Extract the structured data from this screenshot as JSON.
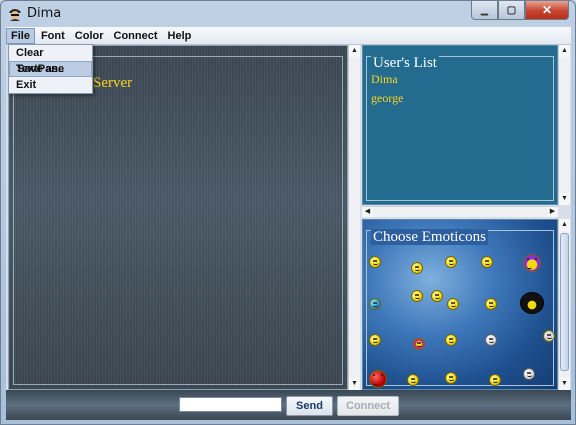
{
  "window": {
    "title": "Dima",
    "close_glyph": "✕",
    "min_glyph": "▁",
    "max_glyph": "▢"
  },
  "menubar": {
    "items": [
      "File",
      "Font",
      "Color",
      "Connect",
      "Help"
    ],
    "active_index": 0
  },
  "file_menu": {
    "items": [
      "Clear TextPane",
      "Save as..",
      "Exit"
    ],
    "hover_index": 1
  },
  "chat": {
    "visible_text": "Server"
  },
  "users": {
    "title": "User's List",
    "items": [
      "Dima",
      "george"
    ]
  },
  "emoticons": {
    "title": "Choose Emoticons"
  },
  "bottom": {
    "message_value": "",
    "send_label": "Send",
    "connect_label": "Connect",
    "connect_enabled": false
  },
  "colors": {
    "chat_text": "#ffd21a",
    "user_text": "#ffd21a",
    "users_bg": "#236c8f"
  },
  "icons": [
    "app-icon",
    "minimize-icon",
    "maximize-icon",
    "close-icon",
    "scroll-up-icon",
    "scroll-down-icon",
    "scroll-left-icon",
    "scroll-right-icon"
  ]
}
